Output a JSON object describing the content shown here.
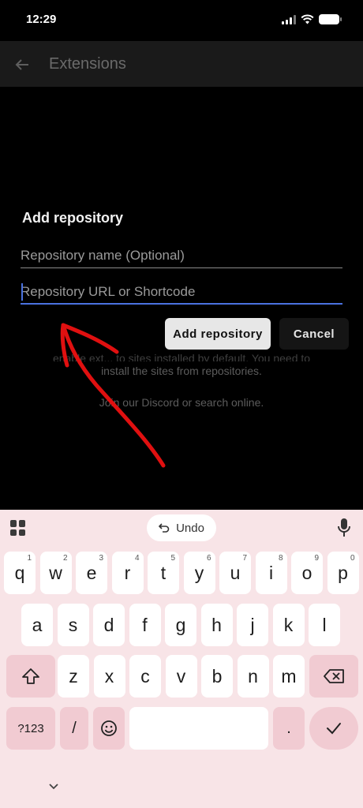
{
  "status_bar": {
    "time": "12:29"
  },
  "app_bar": {
    "title": "Extensions"
  },
  "background": {
    "partial_line": "enable ext... to sites installed by default. You need to",
    "line1": "install the sites from repositories.",
    "line2": "Join our Discord or search online."
  },
  "dialog": {
    "title": "Add repository",
    "name_placeholder": "Repository name (Optional)",
    "name_value": "",
    "url_placeholder": "Repository URL or Shortcode",
    "url_value": "",
    "add_label": "Add repository",
    "cancel_label": "Cancel"
  },
  "keyboard": {
    "undo_label": "Undo",
    "row1": [
      {
        "k": "q",
        "h": "1"
      },
      {
        "k": "w",
        "h": "2"
      },
      {
        "k": "e",
        "h": "3"
      },
      {
        "k": "r",
        "h": "4"
      },
      {
        "k": "t",
        "h": "5"
      },
      {
        "k": "y",
        "h": "6"
      },
      {
        "k": "u",
        "h": "7"
      },
      {
        "k": "i",
        "h": "8"
      },
      {
        "k": "o",
        "h": "9"
      },
      {
        "k": "p",
        "h": "0"
      }
    ],
    "row2": [
      "a",
      "s",
      "d",
      "f",
      "g",
      "h",
      "j",
      "k",
      "l"
    ],
    "row3": [
      "z",
      "x",
      "c",
      "v",
      "b",
      "n",
      "m"
    ],
    "symbols_label": "?123",
    "slash_label": "/",
    "period_label": "."
  },
  "colors": {
    "accent": "#4a72e0",
    "annotation": "#e01010",
    "keyboard_bg": "#f8e4e7",
    "fn_key": "#f1cbd2"
  }
}
